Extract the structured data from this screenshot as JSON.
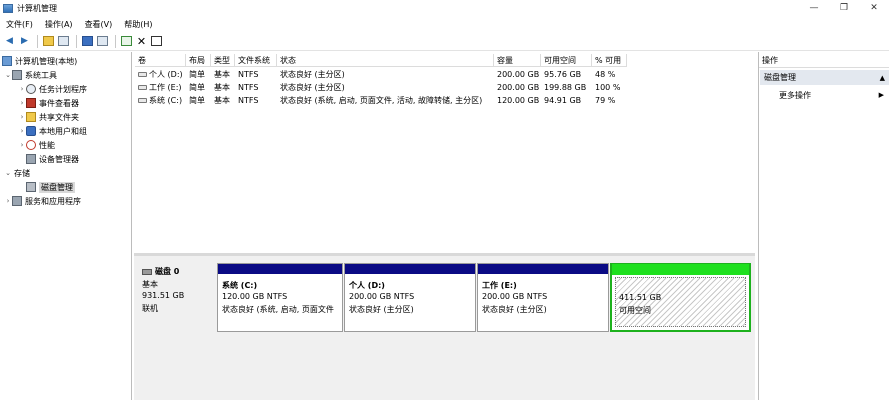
{
  "window": {
    "title": "计算机管理",
    "controls": [
      "—",
      "❐",
      "✕"
    ]
  },
  "menu": [
    {
      "label": "文件(F)"
    },
    {
      "label": "操作(A)"
    },
    {
      "label": "查看(V)"
    },
    {
      "label": "帮助(H)"
    }
  ],
  "toolbar": {
    "back": "◀",
    "forward": "▶",
    "delete": "✕"
  },
  "tree": {
    "root": "计算机管理(本地)",
    "system_tools": "系统工具",
    "task_scheduler": "任务计划程序",
    "event_viewer": "事件查看器",
    "shared_folders": "共享文件夹",
    "local_users": "本地用户和组",
    "performance": "性能",
    "device_manager": "设备管理器",
    "storage": "存储",
    "disk_management": "磁盘管理",
    "services_apps": "服务和应用程序"
  },
  "volumes": {
    "headers": [
      "卷",
      "布局",
      "类型",
      "文件系统",
      "状态",
      "容量",
      "可用空间",
      "% 可用"
    ],
    "rows": [
      {
        "name": "个人 (D:)",
        "layout": "简单",
        "type": "基本",
        "fs": "NTFS",
        "status": "状态良好 (主分区)",
        "capacity": "200.00 GB",
        "free": "95.76 GB",
        "pct": "48 %"
      },
      {
        "name": "工作 (E:)",
        "layout": "简单",
        "type": "基本",
        "fs": "NTFS",
        "status": "状态良好 (主分区)",
        "capacity": "200.00 GB",
        "free": "199.88 GB",
        "pct": "100 %"
      },
      {
        "name": "系统 (C:)",
        "layout": "简单",
        "type": "基本",
        "fs": "NTFS",
        "status": "状态良好 (系统, 启动, 页面文件, 活动, 故障转储, 主分区)",
        "capacity": "120.00 GB",
        "free": "94.91 GB",
        "pct": "79 %"
      }
    ]
  },
  "disk": {
    "name": "磁盘 0",
    "type": "基本",
    "size": "931.51 GB",
    "state": "联机"
  },
  "partitions": [
    {
      "name": "系统  (C:)",
      "size": "120.00 GB NTFS",
      "status": "状态良好 (系统, 启动, 页面文件"
    },
    {
      "name": "个人  (D:)",
      "size": "200.00 GB NTFS",
      "status": "状态良好 (主分区)"
    },
    {
      "name": "工作  (E:)",
      "size": "200.00 GB NTFS",
      "status": "状态良好 (主分区)"
    }
  ],
  "unallocated": {
    "size": "411.51 GB",
    "label": "可用空间"
  },
  "actions": {
    "header": "操作",
    "group": "磁盘管理",
    "more": "更多操作",
    "group_caret": "▲",
    "more_caret": "▶"
  }
}
